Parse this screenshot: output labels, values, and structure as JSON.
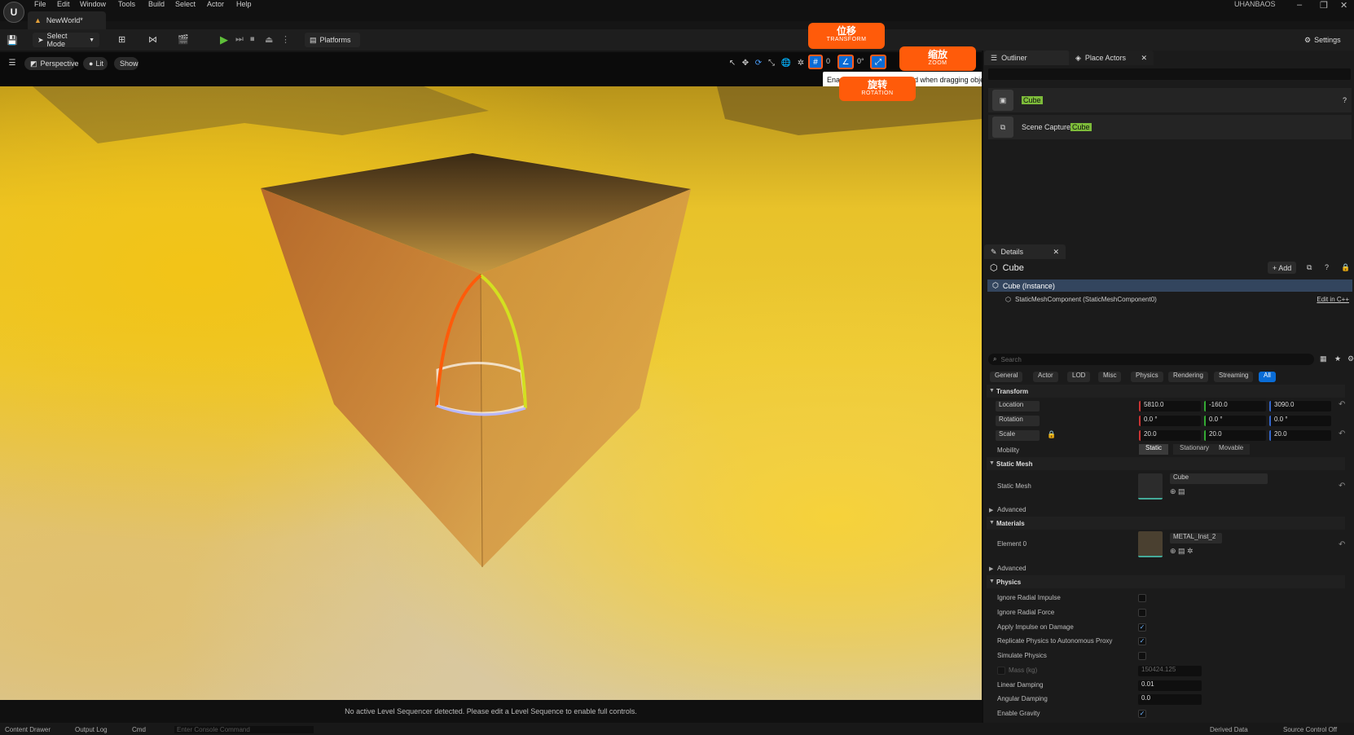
{
  "menubar": {
    "items": [
      "File",
      "Edit",
      "Window",
      "Tools",
      "Build",
      "Select",
      "Actor",
      "Help"
    ],
    "doc_tab": "NewWorld*",
    "app_title": "UHANBAOS",
    "win_min": "–",
    "win_max": "❐",
    "win_close": "✕"
  },
  "toolbar": {
    "select_mode": "Select Mode",
    "platforms": "Platforms",
    "settings": "Settings"
  },
  "viewport_toolbar": {
    "perspective": "Perspective",
    "lit": "Lit",
    "show": "Show",
    "grid_value": "0",
    "rot_value": "0°"
  },
  "callouts": {
    "transform_zh": "位移",
    "transform_en": "TRANSFORM",
    "zoom_zh": "缩放",
    "zoom_en": "ZOOM",
    "rotation_zh": "旋转",
    "rotation_en": "ROTATION"
  },
  "tooltip": {
    "prefix": "Ena",
    "suffix": "to the grid when dragging objects around"
  },
  "viewport": {
    "status_message": "No active Level Sequencer detected. Please edit a Level Sequence to enable full controls."
  },
  "outliner": {
    "tab_outliner": "Outliner",
    "tab_place_actors": "Place Actors",
    "rows": [
      {
        "prefix": "",
        "highlight": "Cube"
      },
      {
        "prefix": "Scene Capture ",
        "highlight": "Cube"
      }
    ]
  },
  "details": {
    "tab": "Details",
    "title": "Cube",
    "add_label": "+ Add",
    "instance": "Cube (Instance)",
    "component": "StaticMeshComponent (StaticMeshComponent0)",
    "edit_cpp": "Edit in C++",
    "search_placeholder": "Search",
    "categories": [
      "General",
      "Actor",
      "LOD",
      "Misc",
      "Physics",
      "Rendering",
      "Streaming",
      "All"
    ],
    "active_category": "All",
    "transform": {
      "header": "Transform",
      "location_label": "Location",
      "location": [
        "5810.0",
        "-160.0",
        "3090.0"
      ],
      "rotation_label": "Rotation",
      "rotation": [
        "0.0 °",
        "0.0 °",
        "0.0 °"
      ],
      "scale_label": "Scale",
      "scale": [
        "20.0",
        "20.0",
        "20.0"
      ],
      "mobility_label": "Mobility",
      "mobility_options": [
        "Static",
        "Stationary",
        "Movable"
      ]
    },
    "static_mesh": {
      "header": "Static Mesh",
      "label": "Static Mesh",
      "value": "Cube",
      "advanced": "Advanced"
    },
    "materials": {
      "header": "Materials",
      "element_label": "Element 0",
      "value": "METAL_Inst_2",
      "advanced": "Advanced"
    },
    "physics": {
      "header": "Physics",
      "ignore_radial_impulse": "Ignore Radial Impulse",
      "ignore_radial_force": "Ignore Radial Force",
      "apply_impulse": "Apply Impulse on Damage",
      "replicate": "Replicate Physics to Autonomous Proxy",
      "simulate": "Simulate Physics",
      "mass_label": "Mass (kg)",
      "mass_value": "150424.125",
      "linear_damping_label": "Linear Damping",
      "linear_damping": "0.01",
      "angular_damping_label": "Angular Damping",
      "angular_damping": "0.0",
      "enable_gravity": "Enable Gravity"
    }
  },
  "bottombar": {
    "content_drawer": "Content Drawer",
    "output_log": "Output Log",
    "cmd": "Cmd",
    "console_placeholder": "Enter Console Command",
    "derived_data": "Derived Data",
    "source_control": "Source Control Off"
  },
  "colors": {
    "accent_orange": "#ff5b0a",
    "selection_blue": "#0a6cd6",
    "highlight_green": "#7dbb3a"
  }
}
